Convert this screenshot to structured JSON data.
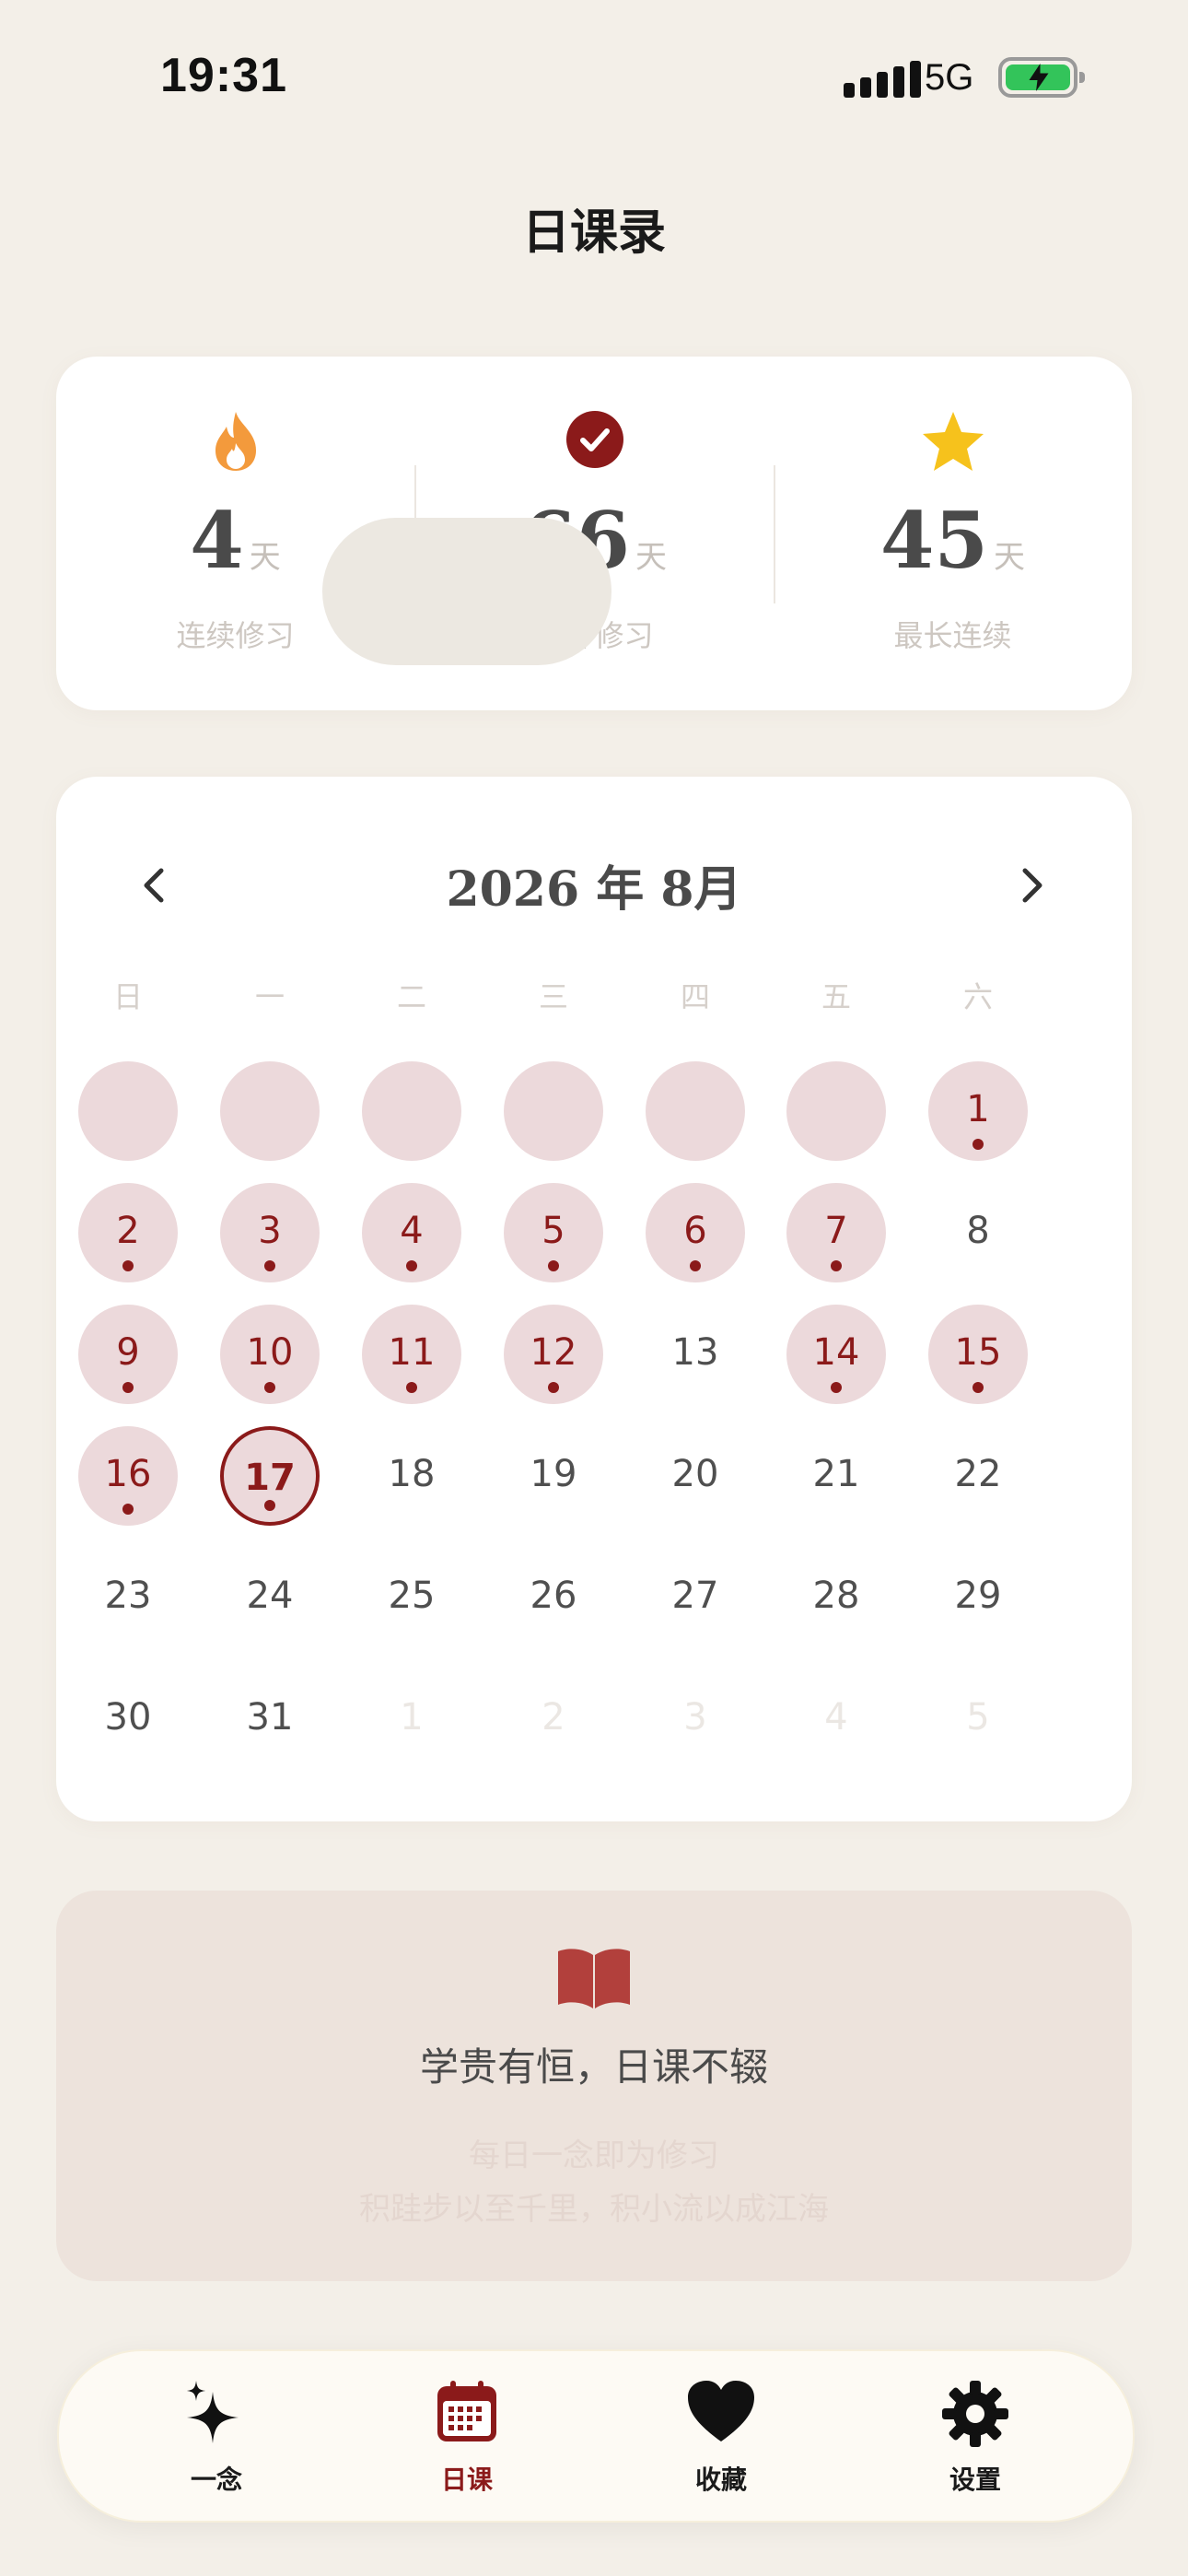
{
  "status": {
    "time": "19:31",
    "network": "5G"
  },
  "page": {
    "title": "日课录"
  },
  "stats": [
    {
      "value": "4",
      "unit": "天",
      "label": "连续修习",
      "icon": "flame-icon"
    },
    {
      "value": "66",
      "unit": "天",
      "label": "累计修习",
      "icon": "check-circle-icon"
    },
    {
      "value": "45",
      "unit": "天",
      "label": "最长连续",
      "icon": "star-icon"
    }
  ],
  "calendar": {
    "title": "2026 年 8月",
    "weekdays": [
      "日",
      "一",
      "二",
      "三",
      "四",
      "五",
      "六"
    ],
    "weeks": [
      [
        {
          "d": "",
          "s": "filled"
        },
        {
          "d": "",
          "s": "filled"
        },
        {
          "d": "",
          "s": "filled"
        },
        {
          "d": "",
          "s": "filled"
        },
        {
          "d": "",
          "s": "filled"
        },
        {
          "d": "",
          "s": "filled"
        },
        {
          "d": "1",
          "s": "done"
        }
      ],
      [
        {
          "d": "2",
          "s": "done"
        },
        {
          "d": "3",
          "s": "done"
        },
        {
          "d": "4",
          "s": "done"
        },
        {
          "d": "5",
          "s": "done"
        },
        {
          "d": "6",
          "s": "done"
        },
        {
          "d": "7",
          "s": "done"
        },
        {
          "d": "8",
          "s": "plain"
        }
      ],
      [
        {
          "d": "9",
          "s": "done"
        },
        {
          "d": "10",
          "s": "done"
        },
        {
          "d": "11",
          "s": "done"
        },
        {
          "d": "12",
          "s": "done"
        },
        {
          "d": "13",
          "s": "plain"
        },
        {
          "d": "14",
          "s": "done"
        },
        {
          "d": "15",
          "s": "done"
        }
      ],
      [
        {
          "d": "16",
          "s": "done"
        },
        {
          "d": "17",
          "s": "today"
        },
        {
          "d": "18",
          "s": "plain"
        },
        {
          "d": "19",
          "s": "plain"
        },
        {
          "d": "20",
          "s": "plain"
        },
        {
          "d": "21",
          "s": "plain"
        },
        {
          "d": "22",
          "s": "plain"
        }
      ],
      [
        {
          "d": "23",
          "s": "plain"
        },
        {
          "d": "24",
          "s": "plain"
        },
        {
          "d": "25",
          "s": "plain"
        },
        {
          "d": "26",
          "s": "plain"
        },
        {
          "d": "27",
          "s": "plain"
        },
        {
          "d": "28",
          "s": "plain"
        },
        {
          "d": "29",
          "s": "plain"
        }
      ],
      [
        {
          "d": "30",
          "s": "plain"
        },
        {
          "d": "31",
          "s": "plain"
        },
        {
          "d": "1",
          "s": "muted"
        },
        {
          "d": "2",
          "s": "muted"
        },
        {
          "d": "3",
          "s": "muted"
        },
        {
          "d": "4",
          "s": "muted"
        },
        {
          "d": "5",
          "s": "muted"
        }
      ]
    ]
  },
  "quote": {
    "icon": "book-icon",
    "title": "学贵有恒，日课不辍",
    "line1": "每日一念即为修习",
    "line2": "积跬步以至千里，积小流以成江海"
  },
  "tabs": [
    {
      "label": "一念",
      "icon": "sparkle-icon",
      "active": false
    },
    {
      "label": "日课",
      "icon": "calendar-icon",
      "active": true
    },
    {
      "label": "收藏",
      "icon": "heart-icon",
      "active": false
    },
    {
      "label": "设置",
      "icon": "gear-icon",
      "active": false
    }
  ],
  "colors": {
    "accent": "#8b1a1a",
    "done_bg": "#ecd9db",
    "background": "#f3efe8"
  }
}
